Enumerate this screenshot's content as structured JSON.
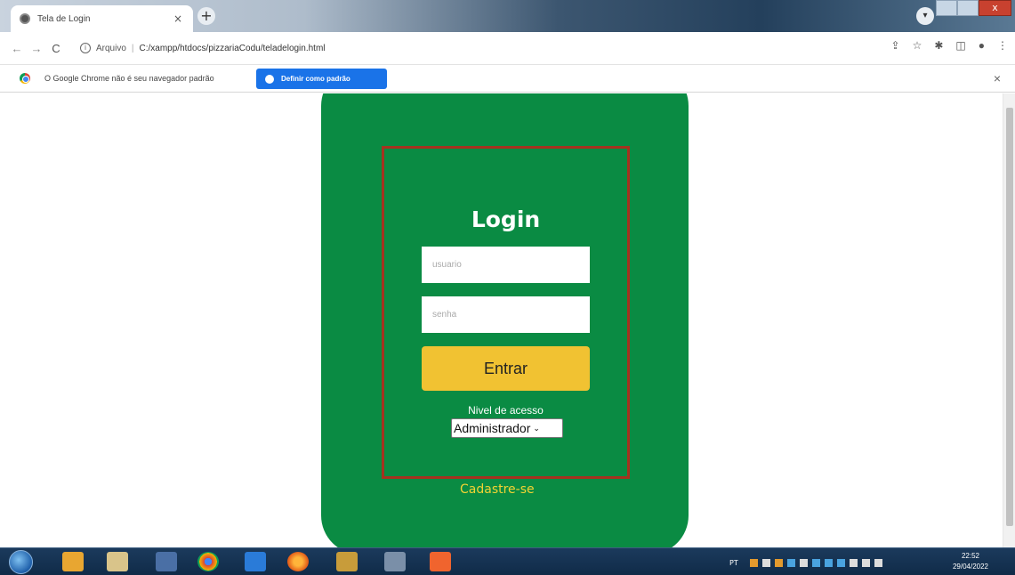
{
  "browser": {
    "tab_title": "Tela de Login",
    "tab_close": "×",
    "new_tab": "+",
    "url_scheme": "Arquivo",
    "url_separator": "|",
    "url_path": "C:/xampp/htdocs/pizzariaCodu/teladelogin.html"
  },
  "infobar": {
    "message": "O Google Chrome não é seu navegador padrão",
    "button_label": "Definir como padrão",
    "close": "×"
  },
  "login": {
    "title": "Login",
    "username_placeholder": "usuario",
    "password_placeholder": "senha",
    "submit_label": "Entrar",
    "access_level_label": "Nivel de acesso",
    "access_level_selected": "Administrador",
    "signup_link": "Cadastre-se"
  },
  "colors": {
    "card_green": "#0a8b43",
    "frame_red": "#a4331f",
    "button_yellow": "#f1c232",
    "link_yellow": "#f1d333",
    "infobar_blue": "#1a73e8"
  },
  "taskbar": {
    "lang": "PT",
    "time": "22:52",
    "date": "29/04/2022"
  }
}
